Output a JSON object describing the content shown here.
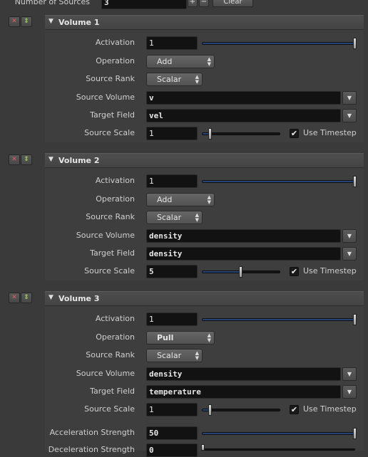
{
  "top": {
    "label": "Number of Sources",
    "value": "3",
    "plus": "+",
    "minus": "−",
    "clear": "Clear"
  },
  "volumes": [
    {
      "title": "Volume 1",
      "activation": "1",
      "activation_level": 1.0,
      "operation": "Add",
      "source_rank": "Scalar",
      "source_volume": "v",
      "target_field": "vel",
      "source_scale": "1",
      "source_scale_level": 0.1,
      "use_timestep": true
    },
    {
      "title": "Volume 2",
      "activation": "1",
      "activation_level": 1.0,
      "operation": "Add",
      "source_rank": "Scalar",
      "source_volume": "density",
      "target_field": "density",
      "source_scale": "5",
      "source_scale_level": 0.5,
      "use_timestep": true
    },
    {
      "title": "Volume 3",
      "activation": "1",
      "activation_level": 1.0,
      "operation": "Pull",
      "source_rank": "Scalar",
      "source_volume": "density",
      "target_field": "temperature",
      "source_scale": "1",
      "source_scale_level": 0.1,
      "use_timestep": true,
      "acceleration_strength": "50",
      "deceleration_strength": "0"
    }
  ],
  "labels": {
    "activation": "Activation",
    "operation": "Operation",
    "source_rank": "Source  Rank",
    "source_volume": "Source Volume",
    "target_field": "Target Field",
    "source_scale": "Source Scale",
    "use_timestep": "Use Timestep",
    "acceleration_strength": "Acceleration Strength",
    "deceleration_strength": "Deceleration Strength"
  },
  "icons": {
    "remove": "✕",
    "duplicate": "⇕",
    "collapse": "▼",
    "menu_arrows": "▲▼",
    "dropdown": "▼",
    "check": "✔"
  },
  "colors": {
    "background": "#3a3a3a",
    "field": "#121212",
    "slider_fill": "#2a4d85",
    "remove_icon": "#e06060",
    "duplicate_icon": "#9acb5a"
  }
}
